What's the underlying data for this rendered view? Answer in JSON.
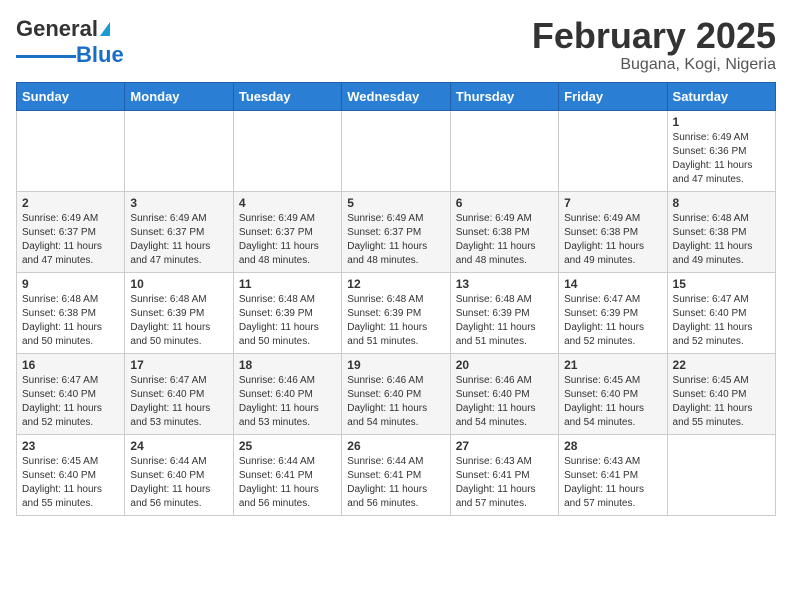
{
  "logo": {
    "text_general": "General",
    "text_blue": "Blue"
  },
  "title": "February 2025",
  "subtitle": "Bugana, Kogi, Nigeria",
  "weekdays": [
    "Sunday",
    "Monday",
    "Tuesday",
    "Wednesday",
    "Thursday",
    "Friday",
    "Saturday"
  ],
  "weeks": [
    [
      {
        "day": "",
        "info": ""
      },
      {
        "day": "",
        "info": ""
      },
      {
        "day": "",
        "info": ""
      },
      {
        "day": "",
        "info": ""
      },
      {
        "day": "",
        "info": ""
      },
      {
        "day": "",
        "info": ""
      },
      {
        "day": "1",
        "info": "Sunrise: 6:49 AM\nSunset: 6:36 PM\nDaylight: 11 hours\nand 47 minutes."
      }
    ],
    [
      {
        "day": "2",
        "info": "Sunrise: 6:49 AM\nSunset: 6:37 PM\nDaylight: 11 hours\nand 47 minutes."
      },
      {
        "day": "3",
        "info": "Sunrise: 6:49 AM\nSunset: 6:37 PM\nDaylight: 11 hours\nand 47 minutes."
      },
      {
        "day": "4",
        "info": "Sunrise: 6:49 AM\nSunset: 6:37 PM\nDaylight: 11 hours\nand 48 minutes."
      },
      {
        "day": "5",
        "info": "Sunrise: 6:49 AM\nSunset: 6:37 PM\nDaylight: 11 hours\nand 48 minutes."
      },
      {
        "day": "6",
        "info": "Sunrise: 6:49 AM\nSunset: 6:38 PM\nDaylight: 11 hours\nand 48 minutes."
      },
      {
        "day": "7",
        "info": "Sunrise: 6:49 AM\nSunset: 6:38 PM\nDaylight: 11 hours\nand 49 minutes."
      },
      {
        "day": "8",
        "info": "Sunrise: 6:48 AM\nSunset: 6:38 PM\nDaylight: 11 hours\nand 49 minutes."
      }
    ],
    [
      {
        "day": "9",
        "info": "Sunrise: 6:48 AM\nSunset: 6:38 PM\nDaylight: 11 hours\nand 50 minutes."
      },
      {
        "day": "10",
        "info": "Sunrise: 6:48 AM\nSunset: 6:39 PM\nDaylight: 11 hours\nand 50 minutes."
      },
      {
        "day": "11",
        "info": "Sunrise: 6:48 AM\nSunset: 6:39 PM\nDaylight: 11 hours\nand 50 minutes."
      },
      {
        "day": "12",
        "info": "Sunrise: 6:48 AM\nSunset: 6:39 PM\nDaylight: 11 hours\nand 51 minutes."
      },
      {
        "day": "13",
        "info": "Sunrise: 6:48 AM\nSunset: 6:39 PM\nDaylight: 11 hours\nand 51 minutes."
      },
      {
        "day": "14",
        "info": "Sunrise: 6:47 AM\nSunset: 6:39 PM\nDaylight: 11 hours\nand 52 minutes."
      },
      {
        "day": "15",
        "info": "Sunrise: 6:47 AM\nSunset: 6:40 PM\nDaylight: 11 hours\nand 52 minutes."
      }
    ],
    [
      {
        "day": "16",
        "info": "Sunrise: 6:47 AM\nSunset: 6:40 PM\nDaylight: 11 hours\nand 52 minutes."
      },
      {
        "day": "17",
        "info": "Sunrise: 6:47 AM\nSunset: 6:40 PM\nDaylight: 11 hours\nand 53 minutes."
      },
      {
        "day": "18",
        "info": "Sunrise: 6:46 AM\nSunset: 6:40 PM\nDaylight: 11 hours\nand 53 minutes."
      },
      {
        "day": "19",
        "info": "Sunrise: 6:46 AM\nSunset: 6:40 PM\nDaylight: 11 hours\nand 54 minutes."
      },
      {
        "day": "20",
        "info": "Sunrise: 6:46 AM\nSunset: 6:40 PM\nDaylight: 11 hours\nand 54 minutes."
      },
      {
        "day": "21",
        "info": "Sunrise: 6:45 AM\nSunset: 6:40 PM\nDaylight: 11 hours\nand 54 minutes."
      },
      {
        "day": "22",
        "info": "Sunrise: 6:45 AM\nSunset: 6:40 PM\nDaylight: 11 hours\nand 55 minutes."
      }
    ],
    [
      {
        "day": "23",
        "info": "Sunrise: 6:45 AM\nSunset: 6:40 PM\nDaylight: 11 hours\nand 55 minutes."
      },
      {
        "day": "24",
        "info": "Sunrise: 6:44 AM\nSunset: 6:40 PM\nDaylight: 11 hours\nand 56 minutes."
      },
      {
        "day": "25",
        "info": "Sunrise: 6:44 AM\nSunset: 6:41 PM\nDaylight: 11 hours\nand 56 minutes."
      },
      {
        "day": "26",
        "info": "Sunrise: 6:44 AM\nSunset: 6:41 PM\nDaylight: 11 hours\nand 56 minutes."
      },
      {
        "day": "27",
        "info": "Sunrise: 6:43 AM\nSunset: 6:41 PM\nDaylight: 11 hours\nand 57 minutes."
      },
      {
        "day": "28",
        "info": "Sunrise: 6:43 AM\nSunset: 6:41 PM\nDaylight: 11 hours\nand 57 minutes."
      },
      {
        "day": "",
        "info": ""
      }
    ]
  ]
}
